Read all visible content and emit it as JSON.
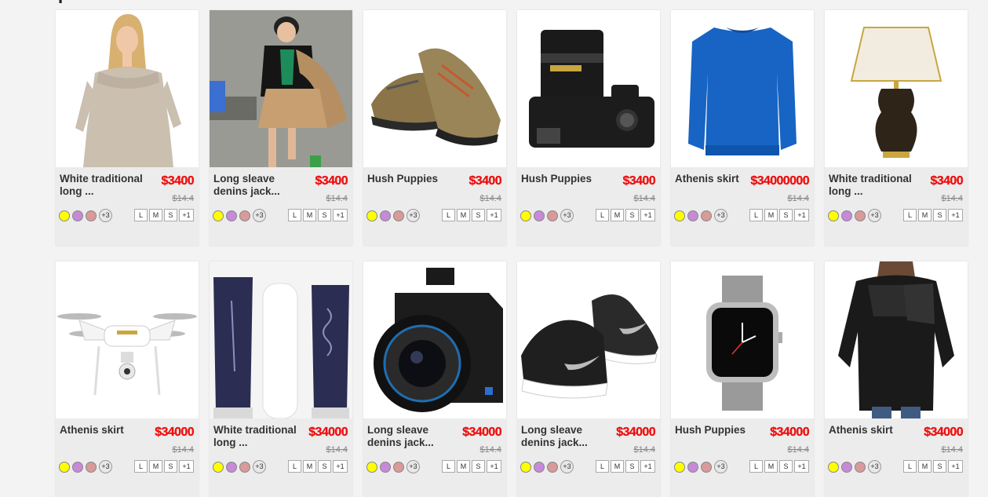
{
  "page_title": "P",
  "colors": {
    "price": "#ee1111",
    "swatch_yellow": "#ffff00",
    "swatch_purple": "#c68ad8",
    "swatch_pink": "#d99a9a"
  },
  "products": [
    {
      "name": "White traditional long ...",
      "price": "$3400",
      "old_price": "$14.4",
      "image": "woman-sweater-image",
      "swatch_more": "+3",
      "sizes": [
        "L",
        "M",
        "S",
        "+1"
      ]
    },
    {
      "name": "Long sleave denins jack...",
      "price": "$3400",
      "old_price": "$14.4",
      "image": "girl-fashion-image",
      "swatch_more": "+3",
      "sizes": [
        "L",
        "M",
        "S",
        "+1"
      ]
    },
    {
      "name": "Hush Puppies",
      "price": "$3400",
      "old_price": "$14.4",
      "image": "hiking-shoes-image",
      "swatch_more": "+3",
      "sizes": [
        "L",
        "M",
        "S",
        "+1"
      ]
    },
    {
      "name": "Hush Puppies",
      "price": "$3400",
      "old_price": "$14.4",
      "image": "dslr-camera-image",
      "swatch_more": "+3",
      "sizes": [
        "L",
        "M",
        "S",
        "+1"
      ]
    },
    {
      "name": "Athenis skirt",
      "price": "$34000000",
      "old_price": "$14.4",
      "image": "blue-sweatshirt-image",
      "swatch_more": "+3",
      "sizes": [
        "L",
        "M",
        "S",
        "+1"
      ]
    },
    {
      "name": "White traditional long ...",
      "price": "$3400",
      "old_price": "$14.4",
      "image": "table-lamp-image",
      "swatch_more": "+3",
      "sizes": [
        "L",
        "M",
        "S",
        "+1"
      ]
    },
    {
      "name": "Athenis skirt",
      "price": "$34000",
      "old_price": "$14.4",
      "image": "drone-image",
      "swatch_more": "+3",
      "sizes": [
        "L",
        "M",
        "S",
        "+1"
      ]
    },
    {
      "name": "White traditional long ...",
      "price": "$34000",
      "old_price": "$14.4",
      "image": "skincare-bottles-image",
      "swatch_more": "+3",
      "sizes": [
        "L",
        "M",
        "S",
        "+1"
      ]
    },
    {
      "name": "Long sleave denins jack...",
      "price": "$34000",
      "old_price": "$14.4",
      "image": "olympus-camera-image",
      "swatch_more": "+3",
      "sizes": [
        "L",
        "M",
        "S",
        "+1"
      ]
    },
    {
      "name": "Long sleave denins jack...",
      "price": "$34000",
      "old_price": "$14.4",
      "image": "nike-sneakers-image",
      "swatch_more": "+3",
      "sizes": [
        "L",
        "M",
        "S",
        "+1"
      ]
    },
    {
      "name": "Hush Puppies",
      "price": "$34000",
      "old_price": "$14.4",
      "image": "smartwatch-image",
      "swatch_more": "+3",
      "sizes": [
        "L",
        "M",
        "S",
        "+1"
      ]
    },
    {
      "name": "Athenis skirt",
      "price": "$34000",
      "old_price": "$14.4",
      "image": "black-blouse-image",
      "swatch_more": "+3",
      "sizes": [
        "L",
        "M",
        "S",
        "+1"
      ]
    }
  ]
}
